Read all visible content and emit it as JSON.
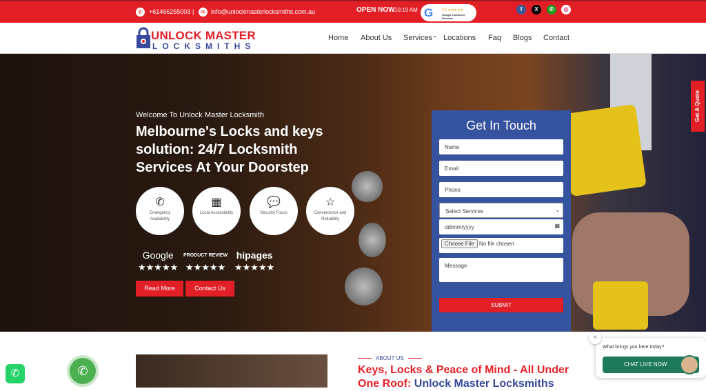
{
  "topbar": {
    "phone": "+61466255003",
    "separator": "|",
    "email": "info@unlockmasterlocksmiths.com.au",
    "open_label": "OPEN NOW",
    "time": "10:19 AM",
    "google_badge": {
      "rating": "5.0",
      "stars": "★★★★★",
      "text": "Google Customer Reviews"
    },
    "social": [
      {
        "icon": "facebook-icon",
        "glyph": "f",
        "color": "#3b5998"
      },
      {
        "icon": "x-icon",
        "glyph": "X",
        "color": "#000000"
      },
      {
        "icon": "whatsapp-icon",
        "glyph": "✆",
        "color": "#1b9b1b"
      },
      {
        "icon": "instagram-icon",
        "glyph": "◎",
        "color": "#e1306c"
      }
    ]
  },
  "logo": {
    "line1": "UNLOCK MASTER",
    "line2": "LOCKSMITHS"
  },
  "nav": {
    "items": [
      "Home",
      "About Us",
      "Services",
      "Locations",
      "Faq",
      "Blogs",
      "Contact"
    ],
    "dropdown": "⌄"
  },
  "hero": {
    "welcome": "Welcome To Unlock Master Locksmith",
    "title": "Melbourne's Locks and keys solution: 24/7 Locksmith Services At Your Doorstep",
    "features": [
      {
        "icon": "phone-icon",
        "glyph": "✆",
        "label": "Emergency Availability"
      },
      {
        "icon": "building-icon",
        "glyph": "▦",
        "label": "Local Accessibility"
      },
      {
        "icon": "chat-bubble-icon",
        "glyph": "💬",
        "label": "Security Focus"
      },
      {
        "icon": "star-icon",
        "glyph": "☆",
        "label": "Convenience and Reliability"
      }
    ],
    "reviews": [
      {
        "name": "Google",
        "stars": "★★★★★"
      },
      {
        "name": "PRODUCT REVIEW",
        "stars": "★★★★★"
      },
      {
        "name": "hipages",
        "stars": "★★★★★"
      }
    ],
    "read_more": "Read More",
    "contact_us": "Contact Us"
  },
  "form": {
    "title": "Get In Touch",
    "name": "Name",
    "email": "Email",
    "phone": "Phone",
    "service": "Select Services",
    "date": "dd/mm/yyyy",
    "file_button": "Choose File",
    "file_status": "No file chosen",
    "message": "Message",
    "submit": "SUBMIT"
  },
  "quote_tab": "Get A Quote",
  "about": {
    "tag": "ABOUT US",
    "title_red": "Keys, Locks & Peace of Mind - All Under One Roof: ",
    "title_blue": "Unlock Master Locksmiths"
  },
  "chat": {
    "question": "What brings you here today?",
    "button": "CHAT LIVE NOW",
    "close": "×"
  },
  "colors": {
    "brand_red": "#e21f26",
    "brand_blue": "#36499b",
    "chat_green": "#1e7a5a"
  }
}
